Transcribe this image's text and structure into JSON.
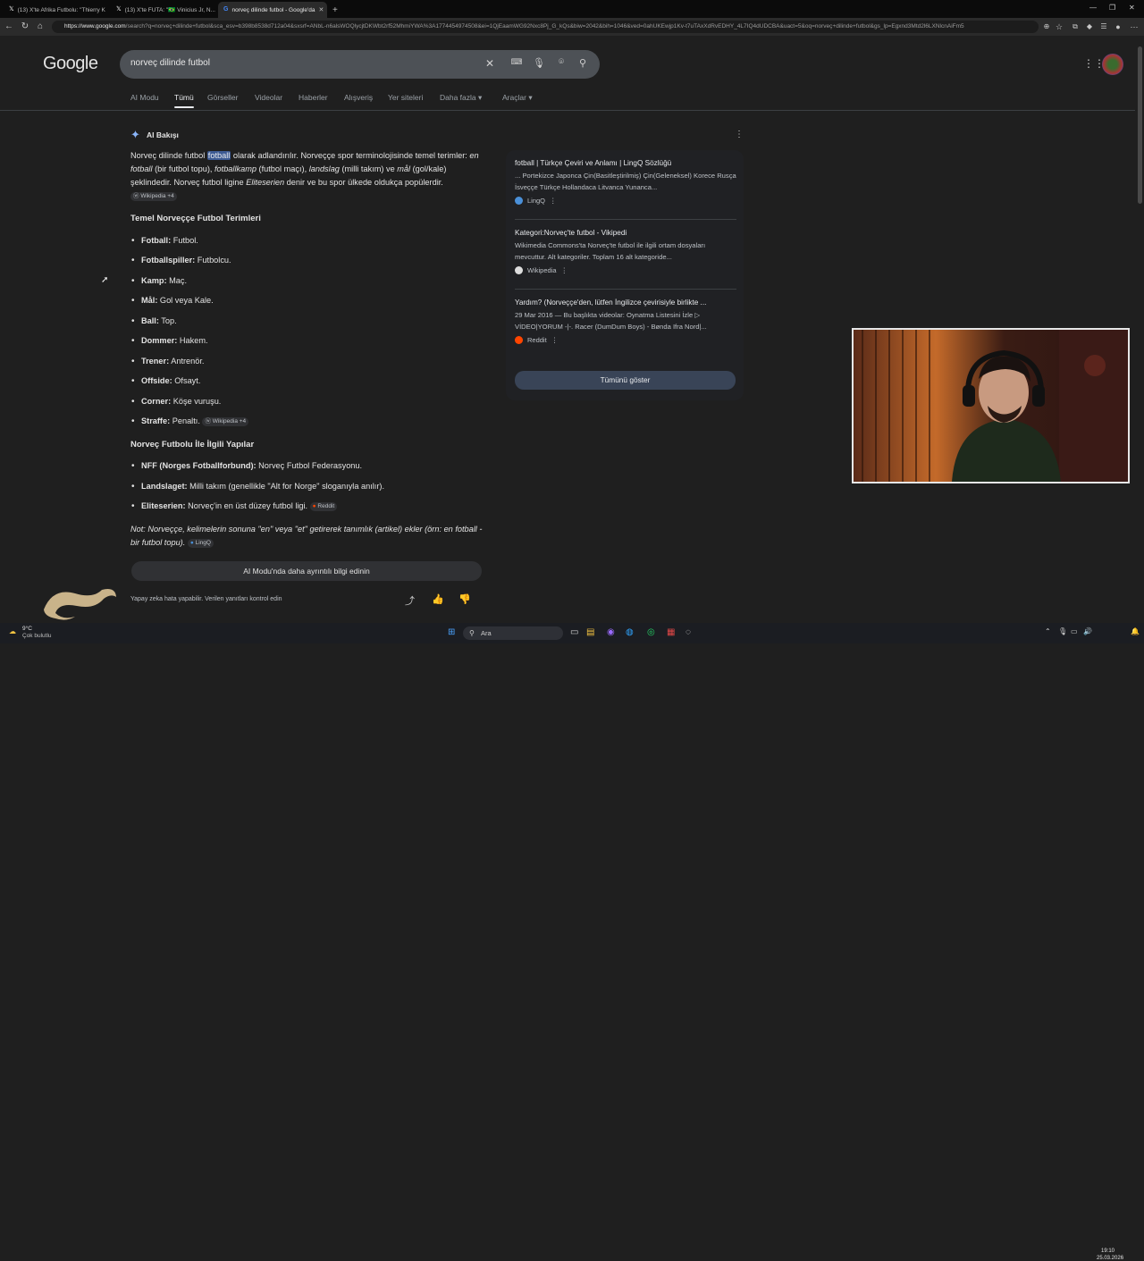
{
  "browser": {
    "tabs": [
      {
        "label": "(13) X'te Afrika Futbolu: \"Thierry K",
        "active": false
      },
      {
        "label": "(13) X'te FUTA: \"🇧🇷 Vinicius Jr, N...",
        "active": false
      },
      {
        "label": "norveç dilinde futbol - Google'da",
        "active": true
      }
    ],
    "address_host": "https://www.google.com",
    "address_rest": "/search?q=norveç+dilinde+futbol&sca_esv=b398b8538d712a04&sxsrf=ANbL-n6alsWOQlycjtDKWbt2rf52MhmiYWA%3A1774454974508&ei=1QjEaamWG92Nxc8Pj_G_kQs&biw=2042&bih=1046&ved=0ahUKEwjp1Kv-t7uTAxXdRvEDHY_4L7IQ4dUDCBA&uact=5&oq=norveç+dilinde+futbol&gs_lp=Egxnd3Mtd2l6LXNlcnAiFm5"
  },
  "google": {
    "logo": "Google",
    "query": "norveç dilinde futbol",
    "tabs": [
      "AI Modu",
      "Tümü",
      "Görseller",
      "Videolar",
      "Haberler",
      "Alışveriş",
      "Yer siteleri",
      "Daha fazla",
      "Araçlar"
    ]
  },
  "ai": {
    "title": "AI Bakışı",
    "intro_1": "Norveç dilinde futbol ",
    "intro_hl": "fotball",
    "intro_2": " olarak adlandırılır. Norveççe spor terminolojisinde temel terimler: ",
    "t1": "en fotball",
    "t1d": " (bir futbol topu), ",
    "t2": "fotballkamp",
    "t2d": " (futbol maçı), ",
    "t3": "landslag",
    "t3d": " (milli takım) ve ",
    "t4": "mål",
    "t4d": " (gol/kale) şeklindedir. Norveç futbol ligine ",
    "t5": "Eliteserien",
    "t5d": " denir ve bu spor ülkede oldukça popülerdir. ",
    "chip_wiki": "Wikipedia +4",
    "h_terms": "Temel Norveççe Futbol Terimleri",
    "terms": [
      {
        "k": "Fotball:",
        "v": " Futbol."
      },
      {
        "k": "Fotballspiller:",
        "v": " Futbolcu."
      },
      {
        "k": "Kamp:",
        "v": " Maç."
      },
      {
        "k": "Mål:",
        "v": " Gol veya Kale."
      },
      {
        "k": "Ball:",
        "v": " Top."
      },
      {
        "k": "Dommer:",
        "v": " Hakem."
      },
      {
        "k": "Trener:",
        "v": " Antrenör."
      },
      {
        "k": "Offside:",
        "v": " Ofsayt."
      },
      {
        "k": "Corner:",
        "v": " Köşe vuruşu."
      },
      {
        "k": "Straffe:",
        "v": " Penaltı."
      }
    ],
    "chip_wiki2": "Wikipedia +4",
    "h_struct": "Norveç Futbolu İle İlgili Yapılar",
    "structs": [
      {
        "k": "NFF (Norges Fotballforbund):",
        "v": " Norveç Futbol Federasyonu."
      },
      {
        "k": "Landslaget:",
        "v": " Milli takım (genellikle \"Alt for Norge\" sloganıyla anılır)."
      },
      {
        "k": "Eliteserien:",
        "v": " Norveç'in en üst düzey futbol ligi."
      }
    ],
    "chip_reddit": "Reddit",
    "note": "Not: Norveççe, kelimelerin sonuna \"en\" veya \"et\" getirerek tanımlık (artikel) ekler (örn: en fotball - bir futbol topu).",
    "chip_lingq": "LingQ",
    "more_button": "AI Modu'nda daha ayrıntılı bilgi edinin",
    "disclaimer": "Yapay zeka hata yapabilir. Verilen yanıtları kontrol edin"
  },
  "sources": [
    {
      "title": "fotball | Türkçe Çeviri ve Anlamı | LingQ Sözlüğü",
      "desc": "... Portekizce Japonca Çin(Basitleştirilmiş) Çin(Geleneksel) Korece Rusça İsveççe Türkçe Hollandaca Litvanca Yunanca...",
      "site": "LingQ",
      "color": "#4a90d9"
    },
    {
      "title": "Kategori:Norveç'te futbol - Vikipedi",
      "desc": "Wikimedia Commons'ta Norveç'te futbol ile ilgili ortam dosyaları mevcuttur. Alt kategoriler. Toplam 16 alt kategoride...",
      "site": "Wikipedia",
      "color": "#dddddd"
    },
    {
      "title": "Yardım? (Norveççe'den, lütfen İngilizce çevirisiyle birlikte ...",
      "desc": "29 Mar 2016 — Bu başlıkta videolar: Oynatma Listesini İzle ▷ VİDEO|YORUM -|-. Racer (DumDum Boys) - Bønda Ifra Nord|...",
      "site": "Reddit",
      "color": "#ff4500"
    }
  ],
  "show_all": "Tümünü göster",
  "taskbar": {
    "weather_temp": "9°C",
    "weather_desc": "Çok bulutlu",
    "search": "Ara",
    "time": "19:10",
    "date": "25.03.2026"
  }
}
